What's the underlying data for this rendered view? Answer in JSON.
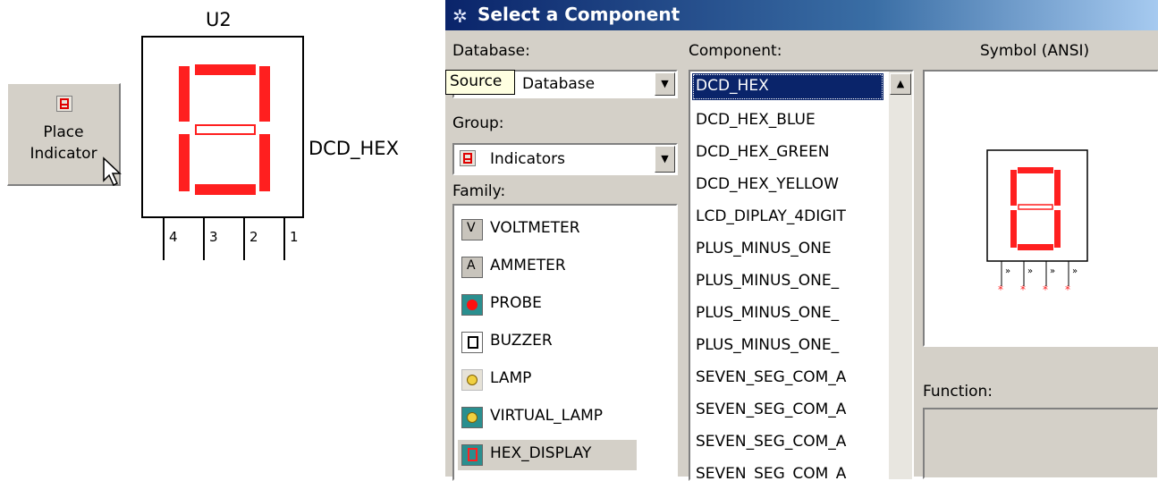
{
  "toolbar": {
    "place_line1": "Place",
    "place_line2": "Indicator"
  },
  "schematic": {
    "ref": "U2",
    "component_name": "DCD_HEX",
    "pins": [
      "4",
      "3",
      "2",
      "1"
    ]
  },
  "dialog": {
    "title": "Select a Component",
    "database_label": "Database:",
    "database_value": "Database",
    "tooltip": "Source",
    "group_label": "Group:",
    "group_value": "Indicators",
    "family_label": "Family:",
    "families": [
      {
        "label": "VOLTMETER",
        "icon": "voltmeter-icon"
      },
      {
        "label": "AMMETER",
        "icon": "ammeter-icon"
      },
      {
        "label": "PROBE",
        "icon": "probe-icon"
      },
      {
        "label": "BUZZER",
        "icon": "buzzer-icon"
      },
      {
        "label": "LAMP",
        "icon": "lamp-icon"
      },
      {
        "label": "VIRTUAL_LAMP",
        "icon": "virtual-lamp-icon"
      },
      {
        "label": "HEX_DISPLAY",
        "icon": "hex-display-icon"
      }
    ],
    "component_label": "Component:",
    "components": [
      "DCD_HEX",
      "DCD_HEX_BLUE",
      "DCD_HEX_GREEN",
      "DCD_HEX_YELLOW",
      "LCD_DIPLAY_4DIGIT",
      "PLUS_MINUS_ONE",
      "PLUS_MINUS_ONE_",
      "PLUS_MINUS_ONE_",
      "PLUS_MINUS_ONE_",
      "SEVEN_SEG_COM_A",
      "SEVEN_SEG_COM_A",
      "SEVEN_SEG_COM_A",
      "SEVEN_SEG_COM_A"
    ],
    "symbol_label": "Symbol (ANSI)",
    "function_label": "Function:"
  },
  "colors": {
    "segment": "#ff1f1f",
    "titlebar": "#0a246a",
    "selection": "#0a246a",
    "face": "#d4d0c8"
  }
}
